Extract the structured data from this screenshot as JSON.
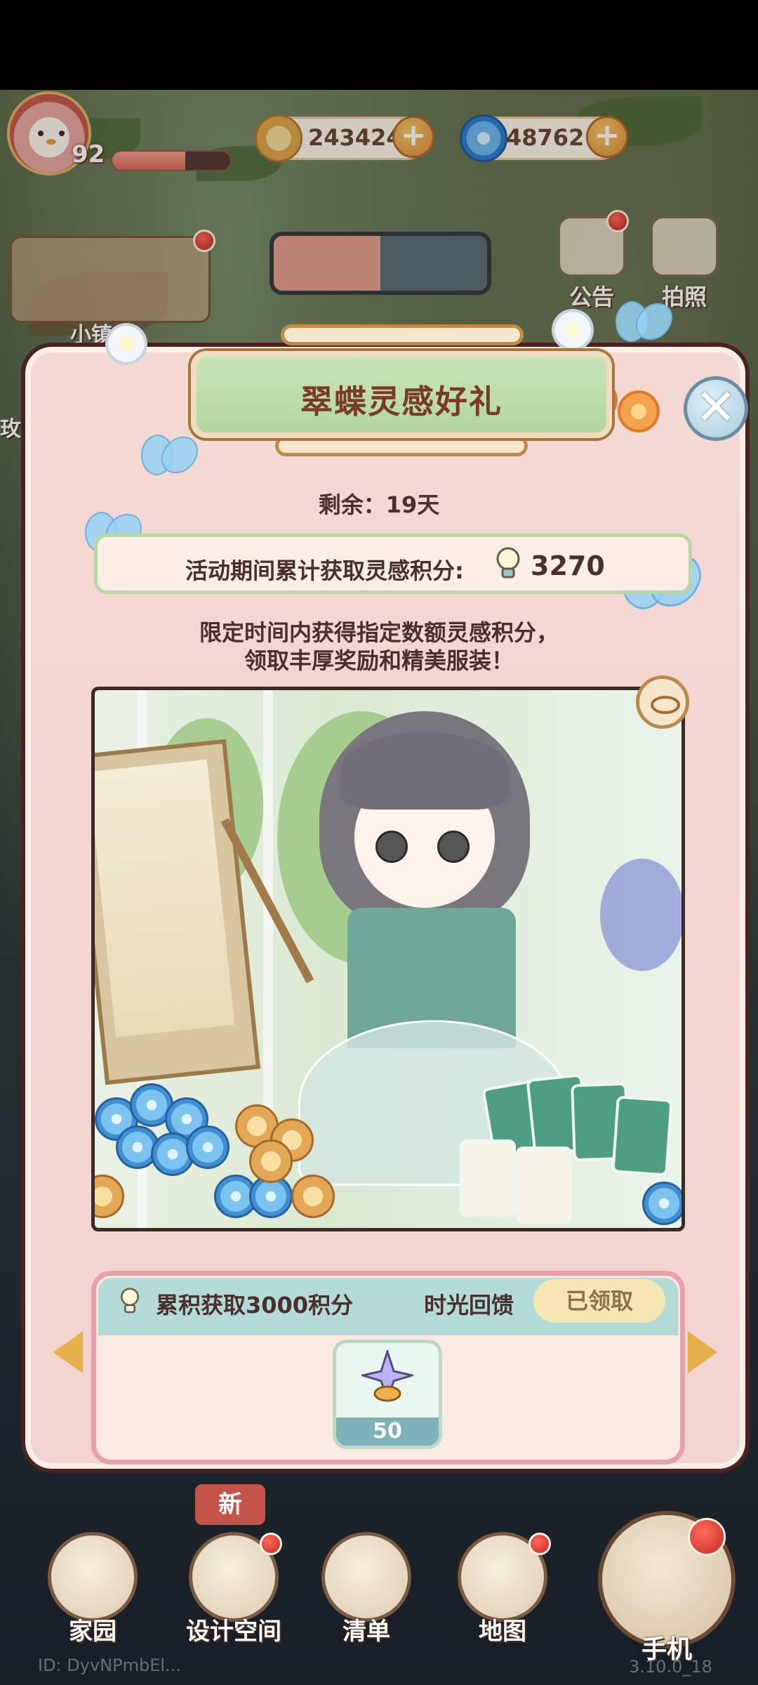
{
  "hud": {
    "level": "92",
    "level_progress": 0.62,
    "coins": "2434249",
    "swirls": "48762",
    "plus": "+"
  },
  "side": {
    "notice_label": "公告",
    "photo_label": "拍照",
    "town_label": "小镇",
    "left_cut_label": "玫"
  },
  "event": {
    "title": "翠蝶灵感好礼",
    "remaining": "剩余：19天",
    "score_label": "活动期间累计获取灵感积分:",
    "score_value": "3270",
    "desc_line1": "限定时间内获得指定数额灵感积分，",
    "desc_line2": "领取丰厚奖励和精美服装！",
    "close": "✕"
  },
  "milestone": {
    "goal": "累积获取3000积分",
    "reward_name": "时光回馈",
    "status": "已领取",
    "item_count": "50"
  },
  "nav": {
    "home": "家园",
    "design": "设计空间",
    "list": "清单",
    "map": "地图",
    "phone": "手机",
    "new_badge": "新"
  },
  "footer": {
    "player_id": "ID: DyvNPmbEl...",
    "version": "3.10.0_18"
  },
  "colors": {
    "panel_bg": "#f4d8d2",
    "title_green": "#c9e4b8",
    "title_text": "#7a3a26",
    "accent_gold": "#e8b04a",
    "badge_red": "#c42a22"
  }
}
